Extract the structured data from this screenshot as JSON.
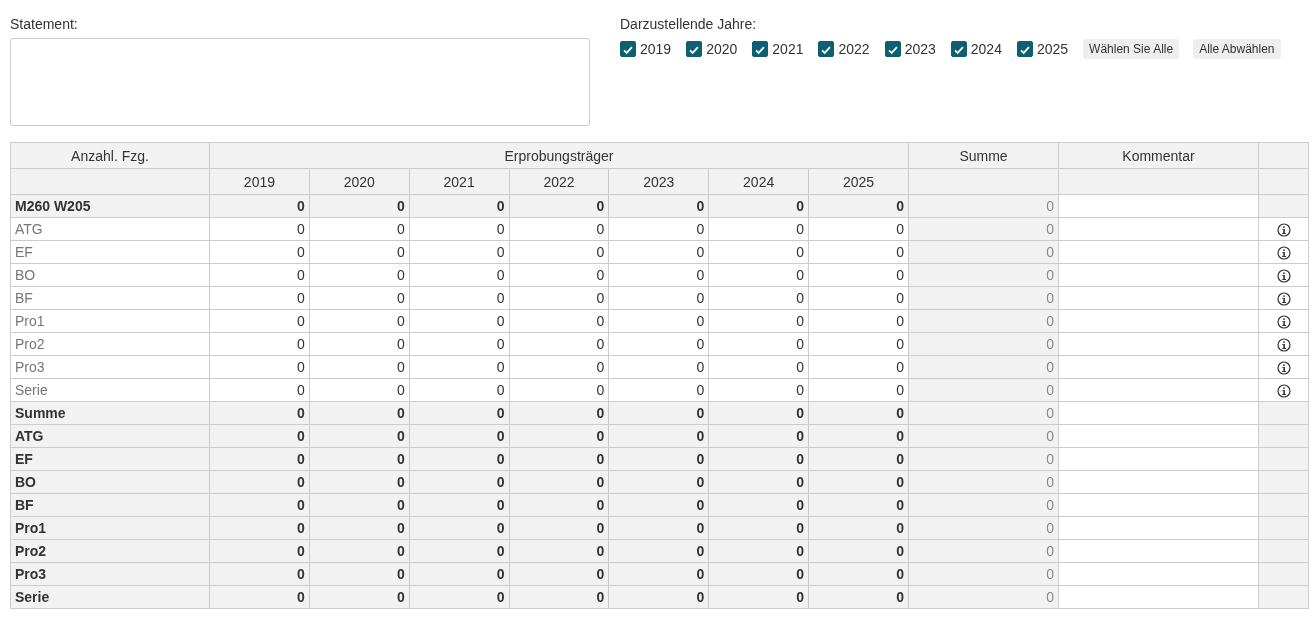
{
  "statement": {
    "label": "Statement:"
  },
  "years_filter": {
    "label": "Darzustellende Jahre:",
    "years": [
      {
        "label": "2019",
        "checked": true
      },
      {
        "label": "2020",
        "checked": true
      },
      {
        "label": "2021",
        "checked": true
      },
      {
        "label": "2022",
        "checked": true
      },
      {
        "label": "2023",
        "checked": true
      },
      {
        "label": "2024",
        "checked": true
      },
      {
        "label": "2025",
        "checked": true
      }
    ],
    "buttons": [
      "Wählen Sie Alle",
      "Alle Abwählen"
    ]
  },
  "table": {
    "header": {
      "label_column": "Anzahl. Fzg.",
      "group": "Erprobungsträger",
      "sum": "Summe",
      "comment": "Kommentar",
      "years": [
        "2019",
        "2020",
        "2021",
        "2022",
        "2023",
        "2024",
        "2025"
      ]
    },
    "rows": [
      {
        "kind": "group",
        "label": "M260 W205",
        "values": [
          "0",
          "0",
          "0",
          "0",
          "0",
          "0",
          "0"
        ],
        "sum": "0"
      },
      {
        "kind": "item",
        "label": "ATG",
        "values": [
          "0",
          "0",
          "0",
          "0",
          "0",
          "0",
          "0"
        ],
        "sum": "0"
      },
      {
        "kind": "item",
        "label": "EF",
        "values": [
          "0",
          "0",
          "0",
          "0",
          "0",
          "0",
          "0"
        ],
        "sum": "0"
      },
      {
        "kind": "item",
        "label": "BO",
        "values": [
          "0",
          "0",
          "0",
          "0",
          "0",
          "0",
          "0"
        ],
        "sum": "0"
      },
      {
        "kind": "item",
        "label": "BF",
        "values": [
          "0",
          "0",
          "0",
          "0",
          "0",
          "0",
          "0"
        ],
        "sum": "0"
      },
      {
        "kind": "item",
        "label": "Pro1",
        "values": [
          "0",
          "0",
          "0",
          "0",
          "0",
          "0",
          "0"
        ],
        "sum": "0"
      },
      {
        "kind": "item",
        "label": "Pro2",
        "values": [
          "0",
          "0",
          "0",
          "0",
          "0",
          "0",
          "0"
        ],
        "sum": "0"
      },
      {
        "kind": "item",
        "label": "Pro3",
        "values": [
          "0",
          "0",
          "0",
          "0",
          "0",
          "0",
          "0"
        ],
        "sum": "0"
      },
      {
        "kind": "item",
        "label": "Serie",
        "values": [
          "0",
          "0",
          "0",
          "0",
          "0",
          "0",
          "0"
        ],
        "sum": "0"
      },
      {
        "kind": "group",
        "label": "Summe",
        "values": [
          "0",
          "0",
          "0",
          "0",
          "0",
          "0",
          "0"
        ],
        "sum": "0"
      },
      {
        "kind": "group",
        "label": "ATG",
        "values": [
          "0",
          "0",
          "0",
          "0",
          "0",
          "0",
          "0"
        ],
        "sum": "0"
      },
      {
        "kind": "group",
        "label": "EF",
        "values": [
          "0",
          "0",
          "0",
          "0",
          "0",
          "0",
          "0"
        ],
        "sum": "0"
      },
      {
        "kind": "group",
        "label": "BO",
        "values": [
          "0",
          "0",
          "0",
          "0",
          "0",
          "0",
          "0"
        ],
        "sum": "0"
      },
      {
        "kind": "group",
        "label": "BF",
        "values": [
          "0",
          "0",
          "0",
          "0",
          "0",
          "0",
          "0"
        ],
        "sum": "0"
      },
      {
        "kind": "group",
        "label": "Pro1",
        "values": [
          "0",
          "0",
          "0",
          "0",
          "0",
          "0",
          "0"
        ],
        "sum": "0"
      },
      {
        "kind": "group",
        "label": "Pro2",
        "values": [
          "0",
          "0",
          "0",
          "0",
          "0",
          "0",
          "0"
        ],
        "sum": "0"
      },
      {
        "kind": "group",
        "label": "Pro3",
        "values": [
          "0",
          "0",
          "0",
          "0",
          "0",
          "0",
          "0"
        ],
        "sum": "0"
      },
      {
        "kind": "group",
        "label": "Serie",
        "values": [
          "0",
          "0",
          "0",
          "0",
          "0",
          "0",
          "0"
        ],
        "sum": "0"
      }
    ]
  }
}
